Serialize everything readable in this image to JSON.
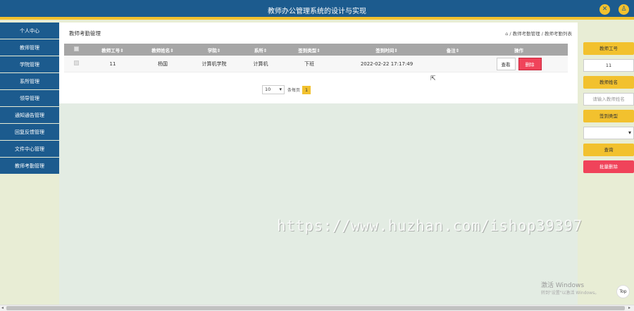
{
  "header": {
    "title": "教师办公管理系统的设计与实现",
    "icon_left": "settings-icon",
    "icon_right": "user-icon",
    "colors": {
      "bar": "#1c5b8e",
      "accent": "#f2c12e"
    }
  },
  "sidebar": {
    "items": [
      {
        "label": "个人中心"
      },
      {
        "label": "教师管理"
      },
      {
        "label": "学院管理"
      },
      {
        "label": "系所管理"
      },
      {
        "label": "领导管理"
      },
      {
        "label": "通知通告管理"
      },
      {
        "label": "回复反馈管理"
      },
      {
        "label": "文件中心管理"
      },
      {
        "label": "教师考勤管理"
      }
    ]
  },
  "main": {
    "page_title": "教师考勤管理",
    "breadcrumb": "⌂ / 教师考勤管理 / 教师考勤列表",
    "table": {
      "headers": [
        "教师工号⇕",
        "教师姓名⇕",
        "学院⇕",
        "系所⇕",
        "签到类型⇕",
        "签到时间⇕",
        "备注⇕",
        "操作"
      ],
      "rows": [
        {
          "teacher_id": "11",
          "teacher_name": "杨国",
          "college": "计算机学院",
          "department": "计算机",
          "sign_type": "下班",
          "sign_time": "2022-02-22 17:17:49",
          "remark": "",
          "view_label": "查看",
          "delete_label": "删除"
        }
      ]
    },
    "pager": {
      "page_size": "10",
      "per_page_label": "条每页",
      "current_page": "1"
    }
  },
  "search": {
    "teacher_id_label": "教师工号",
    "teacher_id_value": "11",
    "teacher_name_label": "教师姓名",
    "teacher_name_placeholder": "请输入教师姓名",
    "sign_type_label": "签到类型",
    "sign_type_value": "",
    "query_label": "查询",
    "batch_delete_label": "批量删除"
  },
  "overlay": {
    "watermark": "https://www.huzhan.com/ishop39397",
    "windows_line1": "激活 Windows",
    "windows_line2": "转到\"设置\"以激活 Windows。",
    "top_button": "Top"
  }
}
